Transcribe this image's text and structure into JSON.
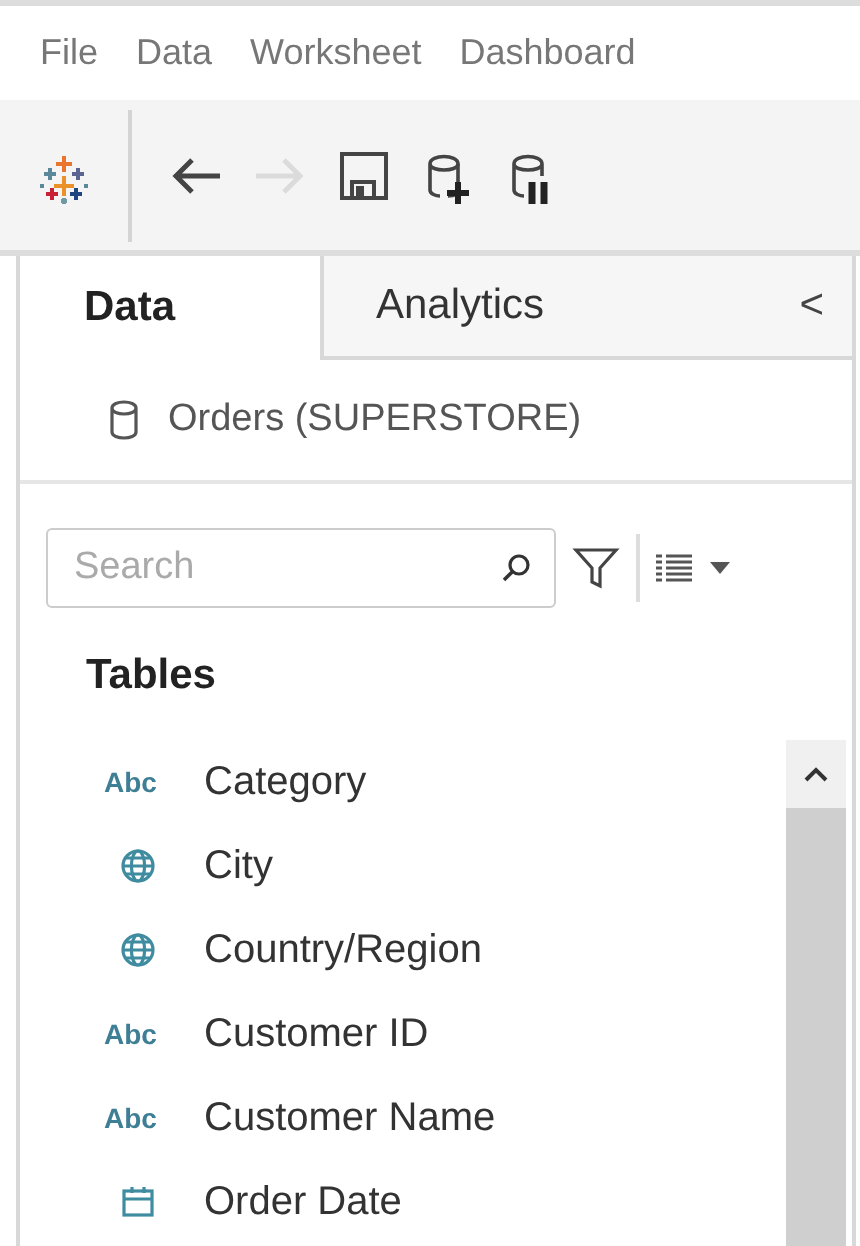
{
  "menu": [
    "File",
    "Data",
    "Worksheet",
    "Dashboard"
  ],
  "toolbar": [
    {
      "kind": "logo",
      "disabled": false
    },
    {
      "kind": "back",
      "disabled": false
    },
    {
      "kind": "forward",
      "disabled": true
    },
    {
      "kind": "save",
      "disabled": false
    },
    {
      "kind": "add-source",
      "disabled": false
    },
    {
      "kind": "pause-source",
      "disabled": false
    }
  ],
  "tabs": [
    {
      "label": "Data",
      "selected": true
    },
    {
      "label": "Analytics",
      "selected": false
    }
  ],
  "collapse": "<",
  "data_source": "Orders (SUPERSTORE)",
  "search": {
    "placeholder": "Search"
  },
  "section_title": "Tables",
  "fields": [
    {
      "kind": "string",
      "type_label": "Abc",
      "name": "Category"
    },
    {
      "kind": "geo",
      "name": "City"
    },
    {
      "kind": "geo",
      "name": "Country/Region"
    },
    {
      "kind": "string",
      "type_label": "Abc",
      "name": "Customer ID"
    },
    {
      "kind": "string",
      "type_label": "Abc",
      "name": "Customer Name"
    },
    {
      "kind": "date",
      "name": "Order Date"
    }
  ]
}
